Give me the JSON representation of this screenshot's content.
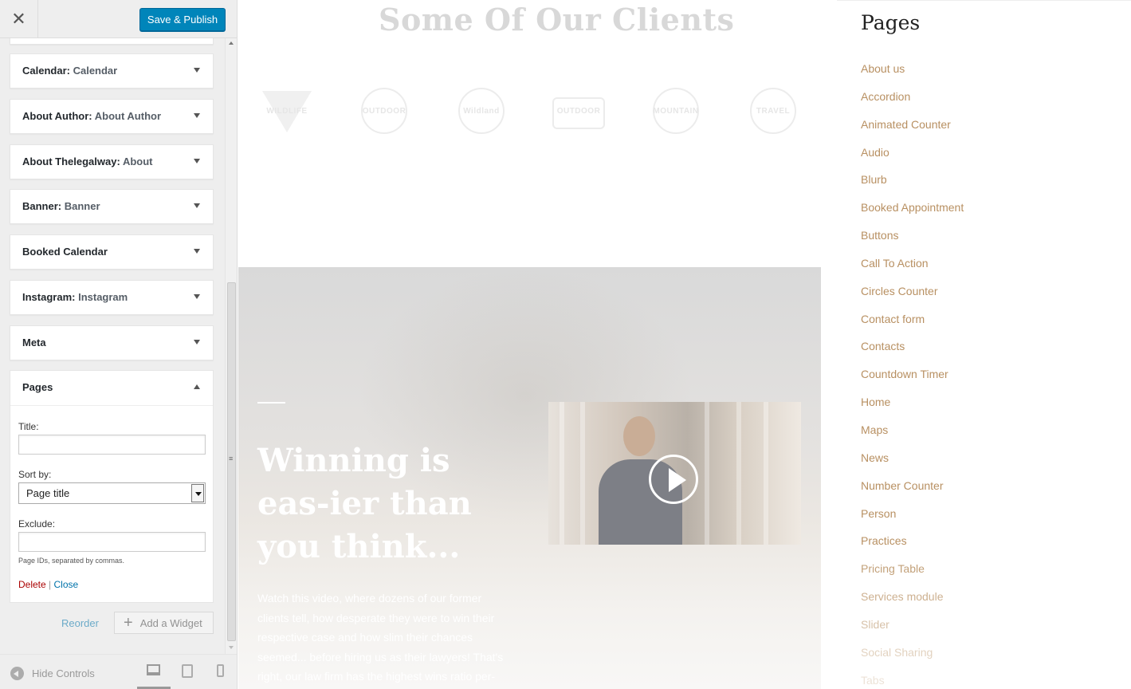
{
  "header": {
    "close_icon": "close-icon",
    "save_label": "Save & Publish"
  },
  "widgets": [
    {
      "type": "Calendar",
      "title": "Calendar"
    },
    {
      "type": "About Author",
      "title": "About Author"
    },
    {
      "type": "About Thelegalway",
      "title": "About"
    },
    {
      "type": "Banner",
      "title": "Banner"
    },
    {
      "type": "Booked Calendar",
      "title": ""
    },
    {
      "type": "Instagram",
      "title": "Instagram"
    },
    {
      "type": "Meta",
      "title": ""
    }
  ],
  "pages_widget": {
    "header": "Pages",
    "title_label": "Title:",
    "title_value": "",
    "sortby_label": "Sort by:",
    "sortby_value": "Page title",
    "exclude_label": "Exclude:",
    "exclude_value": "",
    "exclude_hint": "Page IDs, separated by commas.",
    "delete_label": "Delete",
    "separator": "|",
    "close_label": "Close"
  },
  "sidebar_actions": {
    "reorder_label": "Reorder",
    "add_widget_label": "Add a Widget"
  },
  "footer": {
    "hide_controls_label": "Hide Controls"
  },
  "preview": {
    "clients_title": "Some Of Our Clients",
    "client_logos": [
      "WILDLIFE",
      "OUTDOOR",
      "Wildland",
      "OUTDOOR",
      "MOUNTAIN",
      "TRAVEL"
    ],
    "hero_heading": "Winning is eas-ier than you think...",
    "hero_text": "Watch this video, where dozens of our former clients tell, how desperate they were to win their respective case and how slim their chances seemed... before hiring us as their lawyers! That's right, our law firm has the highest wins ratio per-",
    "pages_title": "Pages",
    "pages": [
      "About us",
      "Accordion",
      "Animated Counter",
      "Audio",
      "Blurb",
      "Booked Appointment",
      "Buttons",
      "Call To Action",
      "Circles Counter",
      "Contact form",
      "Contacts",
      "Countdown Timer",
      "Home",
      "Maps",
      "News",
      "Number Counter",
      "Person",
      "Practices",
      "Pricing Table",
      "Services module",
      "Slider",
      "Social Sharing",
      "Tabs"
    ]
  },
  "colors": {
    "primary_button": "#0085ba",
    "link": "#0073aa",
    "delete": "#a00000",
    "page_link": "#b89062"
  }
}
